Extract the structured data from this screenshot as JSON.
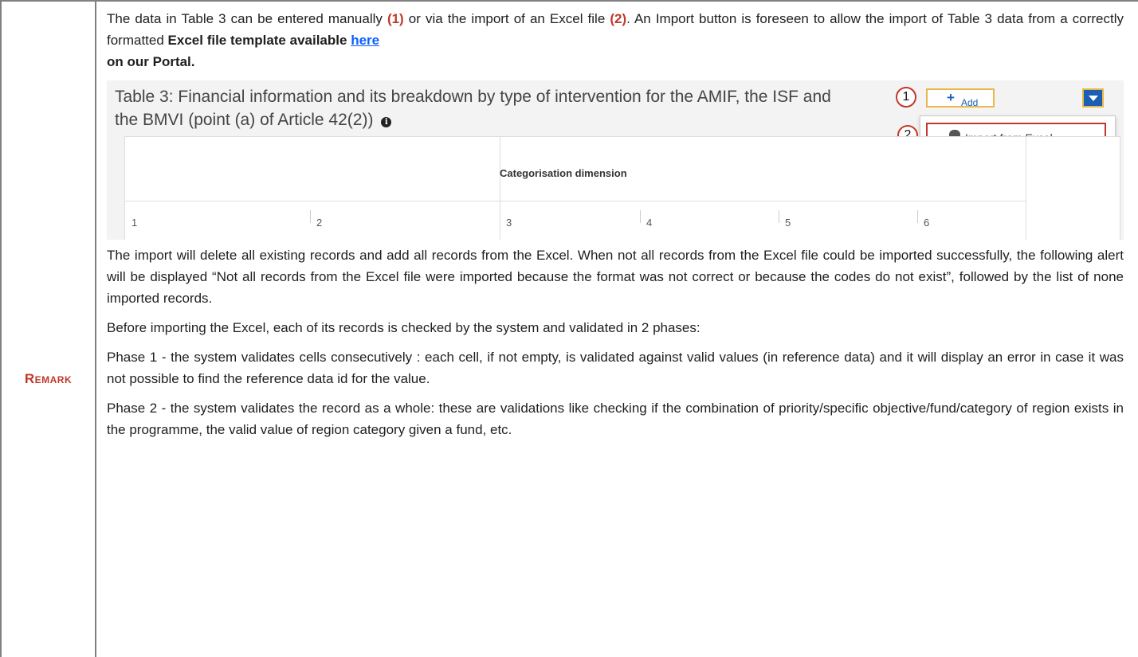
{
  "left": {
    "remark": "Remark"
  },
  "intro": {
    "t1": "The data in Table 3 can be entered manually ",
    "m1": "(1)",
    "t2": " or via the import of an Excel file ",
    "m2": "(2)",
    "t3": ". An Import button is foreseen to allow the import of Table 3 data from a correctly formatted ",
    "bold1": "Excel file template available",
    "link": "here",
    "bold2": "on our Portal."
  },
  "screenshot": {
    "title": "Table 3: Financial information and its breakdown by type of intervention for the AMIF, the ISF and the BMVI (point (a) of Article 42(2))",
    "marker1": "1",
    "marker2": "2",
    "add_label": "Add",
    "menu_item": "Import from Excel...",
    "category_header": "Categorisation dimension",
    "columns": [
      "1",
      "2",
      "3",
      "4",
      "5",
      "6"
    ]
  },
  "paragraphs": {
    "p1": "The import will delete all existing records and add all records from the Excel. When not all records from the Excel file could be imported successfully, the following alert will be displayed “Not all records from the Excel file were imported because the format was not correct or because the codes do not exist”, followed by the list of none imported records.",
    "p2": "Before importing the Excel, each of its records is checked by the system and validated in 2 phases:",
    "p3": "Phase 1 - the system validates cells consecutively : each cell, if not empty, is validated against valid values (in reference data) and it will display an error in case it was not possible to find the reference data id for the value.",
    "p4": "Phase 2 - the system validates the record as a whole: these are validations like checking if the combination of priority/specific objective/fund/category of region exists in the programme, the valid value of region category given a fund, etc."
  },
  "colors": {
    "accent_red": "#c0392b",
    "link_blue": "#0b5fff",
    "button_blue": "#1a5fb4",
    "highlight": "#e8b84a"
  }
}
